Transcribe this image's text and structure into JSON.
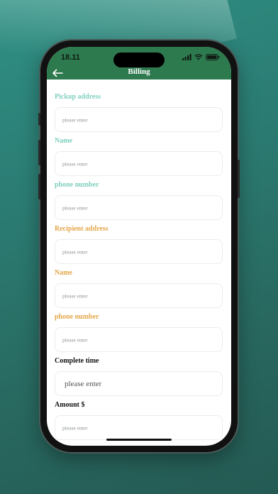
{
  "status_bar": {
    "time": "18.11"
  },
  "header": {
    "title": "Billing"
  },
  "colors": {
    "appbar": "#2e7a4f",
    "pickup_label": "#7ecfbf",
    "recipient_label": "#e4a649",
    "default_label": "#111111"
  },
  "fields": [
    {
      "label": "Pickup address",
      "placeholder": "please enter"
    },
    {
      "label": "Name",
      "placeholder": "please enter"
    },
    {
      "label": "phone number",
      "placeholder": "please enter"
    },
    {
      "label": "Recipient address",
      "placeholder": "please enter"
    },
    {
      "label": "Name",
      "placeholder": "please enter"
    },
    {
      "label": "phone number",
      "placeholder": "please enter"
    },
    {
      "label": "Complete time",
      "placeholder": "please enter"
    },
    {
      "label": "Amount $",
      "placeholder": "please enter"
    }
  ]
}
